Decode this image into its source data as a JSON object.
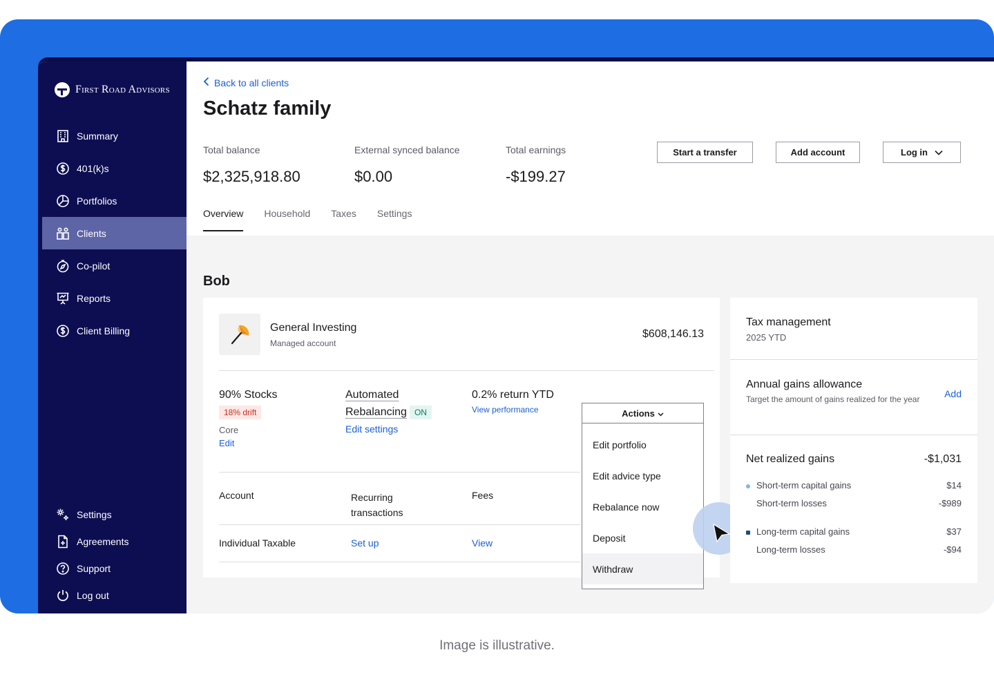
{
  "brand": {
    "name": "First Road Advisors"
  },
  "sidebar": {
    "items": [
      {
        "label": "Summary",
        "icon": "building-icon"
      },
      {
        "label": "401(k)s",
        "icon": "dollar-circle-icon"
      },
      {
        "label": "Portfolios",
        "icon": "pie-chart-icon"
      },
      {
        "label": "Clients",
        "icon": "people-icon",
        "active": true
      },
      {
        "label": "Co-pilot",
        "icon": "compass-icon"
      },
      {
        "label": "Reports",
        "icon": "presentation-icon"
      },
      {
        "label": "Client Billing",
        "icon": "dollar-circle-icon"
      }
    ],
    "bottom": [
      {
        "label": "Settings",
        "icon": "gears-icon"
      },
      {
        "label": "Agreements",
        "icon": "document-plus-icon"
      },
      {
        "label": "Support",
        "icon": "question-circle-icon"
      },
      {
        "label": "Log out",
        "icon": "power-icon"
      }
    ]
  },
  "header": {
    "back_label": "Back to all clients",
    "title": "Schatz family",
    "stats": [
      {
        "label": "Total balance",
        "value": "$2,325,918.80"
      },
      {
        "label": "External synced balance",
        "value": "$0.00"
      },
      {
        "label": "Total earnings",
        "value": "-$199.27"
      }
    ],
    "buttons": {
      "transfer": "Start a transfer",
      "add_account": "Add account",
      "login": "Log in"
    },
    "tabs": [
      "Overview",
      "Household",
      "Taxes",
      "Settings"
    ]
  },
  "person": "Bob",
  "account": {
    "name": "General Investing",
    "sub": "Managed account",
    "value": "$608,146.13",
    "allocation": "90% Stocks",
    "drift": "18% drift",
    "model": "Core",
    "edit": "Edit",
    "rebalancing_line1": "Automated",
    "rebalancing_line2": "Rebalancing",
    "rebalancing_status": "ON",
    "edit_settings": "Edit settings",
    "return": "0.2% return YTD",
    "view_performance": "View performance",
    "table": {
      "headers": [
        "Account",
        "Recurring transactions",
        "Fees"
      ],
      "row": {
        "account": "Individual Taxable",
        "recurring": "Set up",
        "fees": "View"
      }
    }
  },
  "actions": {
    "label": "Actions",
    "items": [
      "Edit portfolio",
      "Edit advice type",
      "Rebalance now",
      "Deposit",
      "Withdraw"
    ]
  },
  "tax": {
    "title": "Tax management",
    "period": "2025 YTD",
    "allowance_title": "Annual gains allowance",
    "allowance_desc": "Target the amount of gains realized for the year",
    "allowance_action": "Add",
    "net_title": "Net realized gains",
    "net_value": "-$1,031",
    "short_gains_label": "Short-term capital gains",
    "short_gains_value": "$14",
    "short_losses_label": "Short-term losses",
    "short_losses_value": "-$989",
    "long_gains_label": "Long-term capital gains",
    "long_gains_value": "$37",
    "long_losses_label": "Long-term losses",
    "long_losses_value": "-$94",
    "short_color": "#7fb8d6",
    "long_color": "#1f4f6e"
  },
  "caption": "Image is illustrative.",
  "colors": {
    "frame": "#1e6de3",
    "sidebar": "#0d0e52",
    "active_nav": "#5d65a6",
    "link": "#1a5fd6"
  }
}
